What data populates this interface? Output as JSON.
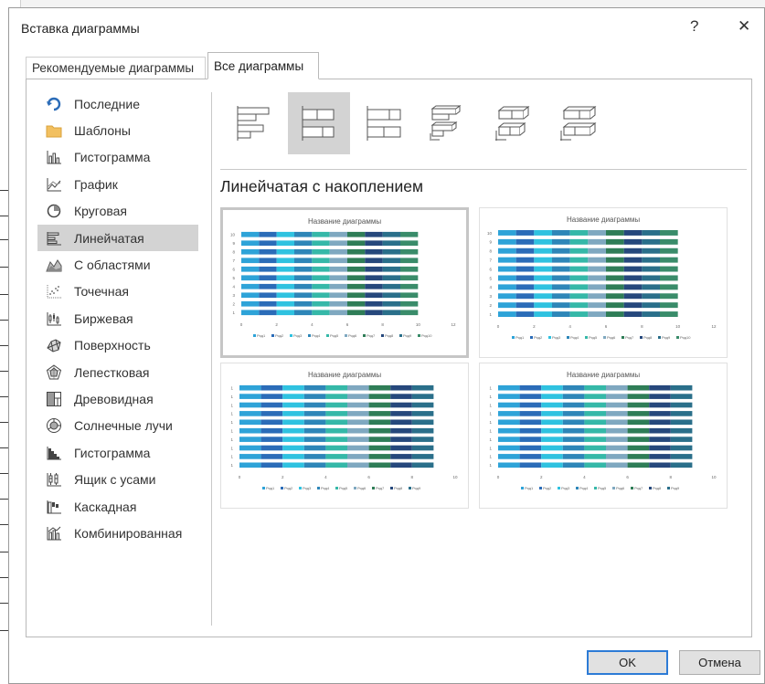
{
  "dialog": {
    "title": "Вставка диаграммы",
    "help_glyph": "?",
    "close_glyph": "✕"
  },
  "tabs": [
    {
      "label": "Рекомендуемые диаграммы"
    },
    {
      "label": "Все диаграммы"
    }
  ],
  "sidebar": {
    "items": [
      {
        "label": "Последние",
        "icon": "recent-icon"
      },
      {
        "label": "Шаблоны",
        "icon": "folder-icon"
      },
      {
        "label": "Гистограмма",
        "icon": "column-chart-icon"
      },
      {
        "label": "График",
        "icon": "line-chart-icon"
      },
      {
        "label": "Круговая",
        "icon": "pie-chart-icon"
      },
      {
        "label": "Линейчатая",
        "icon": "bar-chart-icon",
        "selected": true
      },
      {
        "label": "С областями",
        "icon": "area-chart-icon"
      },
      {
        "label": "Точечная",
        "icon": "scatter-chart-icon"
      },
      {
        "label": "Биржевая",
        "icon": "stock-chart-icon"
      },
      {
        "label": "Поверхность",
        "icon": "surface-chart-icon"
      },
      {
        "label": "Лепестковая",
        "icon": "radar-chart-icon"
      },
      {
        "label": "Древовидная",
        "icon": "treemap-chart-icon"
      },
      {
        "label": "Солнечные лучи",
        "icon": "sunburst-chart-icon"
      },
      {
        "label": "Гистограмма",
        "icon": "histogram-chart-icon"
      },
      {
        "label": "Ящик с усами",
        "icon": "box-whisker-chart-icon"
      },
      {
        "label": "Каскадная",
        "icon": "waterfall-chart-icon"
      },
      {
        "label": "Комбинированная",
        "icon": "combo-chart-icon"
      }
    ]
  },
  "subtypes": [
    {
      "icon": "clustered-bar-icon"
    },
    {
      "icon": "stacked-bar-icon",
      "selected": true
    },
    {
      "icon": "100-stacked-bar-icon"
    },
    {
      "icon": "3d-clustered-bar-icon"
    },
    {
      "icon": "3d-stacked-bar-icon"
    },
    {
      "icon": "3d-100-stacked-bar-icon"
    }
  ],
  "section_title": "Линейчатая с накоплением",
  "previews": [
    {
      "title": "Название диаграммы",
      "rows": [
        "10",
        "9",
        "8",
        "7",
        "6",
        "5",
        "4",
        "3",
        "2",
        "1"
      ],
      "x_ticks": [
        "0",
        "2",
        "4",
        "6",
        "8",
        "10",
        "12"
      ],
      "legend": [
        "Ряд1",
        "Ряд2",
        "Ряд3",
        "Ряд4",
        "Ряд5",
        "Ряд6",
        "Ряд7",
        "Ряд8",
        "Ряд9",
        "Ряд10"
      ],
      "selected": true
    },
    {
      "title": "Название диаграммы",
      "rows": [
        "10",
        "9",
        "8",
        "7",
        "6",
        "5",
        "4",
        "3",
        "2",
        "1"
      ],
      "x_ticks": [
        "0",
        "2",
        "4",
        "6",
        "8",
        "10",
        "12"
      ],
      "legend": [
        "Ряд1",
        "Ряд2",
        "Ряд3",
        "Ряд4",
        "Ряд5",
        "Ряд6",
        "Ряд7",
        "Ряд8",
        "Ряд9",
        "Ряд10"
      ]
    },
    {
      "title": "Название диаграммы",
      "rows": [
        "1",
        "1",
        "1",
        "1",
        "1",
        "1",
        "1",
        "1",
        "1",
        "1"
      ],
      "x_ticks": [
        "0",
        "2",
        "4",
        "6",
        "8",
        "10"
      ],
      "legend": [
        "Ряд1",
        "Ряд2",
        "Ряд3",
        "Ряд4",
        "Ряд5",
        "Ряд6",
        "Ряд7",
        "Ряд8",
        "Ряд9"
      ]
    },
    {
      "title": "Название диаграммы",
      "rows": [
        "1",
        "1",
        "1",
        "1",
        "1",
        "1",
        "1",
        "1",
        "1",
        "1"
      ],
      "x_ticks": [
        "0",
        "2",
        "4",
        "6",
        "8",
        "10"
      ],
      "legend": [
        "Ряд1",
        "Ряд2",
        "Ряд3",
        "Ряд4",
        "Ряд5",
        "Ряд6",
        "Ряд7",
        "Ряд8",
        "Ряд9"
      ]
    }
  ],
  "series_colors": [
    "#2ea3d8",
    "#2b6cb8",
    "#2fc2e0",
    "#2e86b8",
    "#35b8a8",
    "#7fa8c0",
    "#2f7d57",
    "#26487c",
    "#2a6f8a",
    "#3a8c6a"
  ],
  "buttons": {
    "ok": "OK",
    "cancel": "Отмена"
  }
}
